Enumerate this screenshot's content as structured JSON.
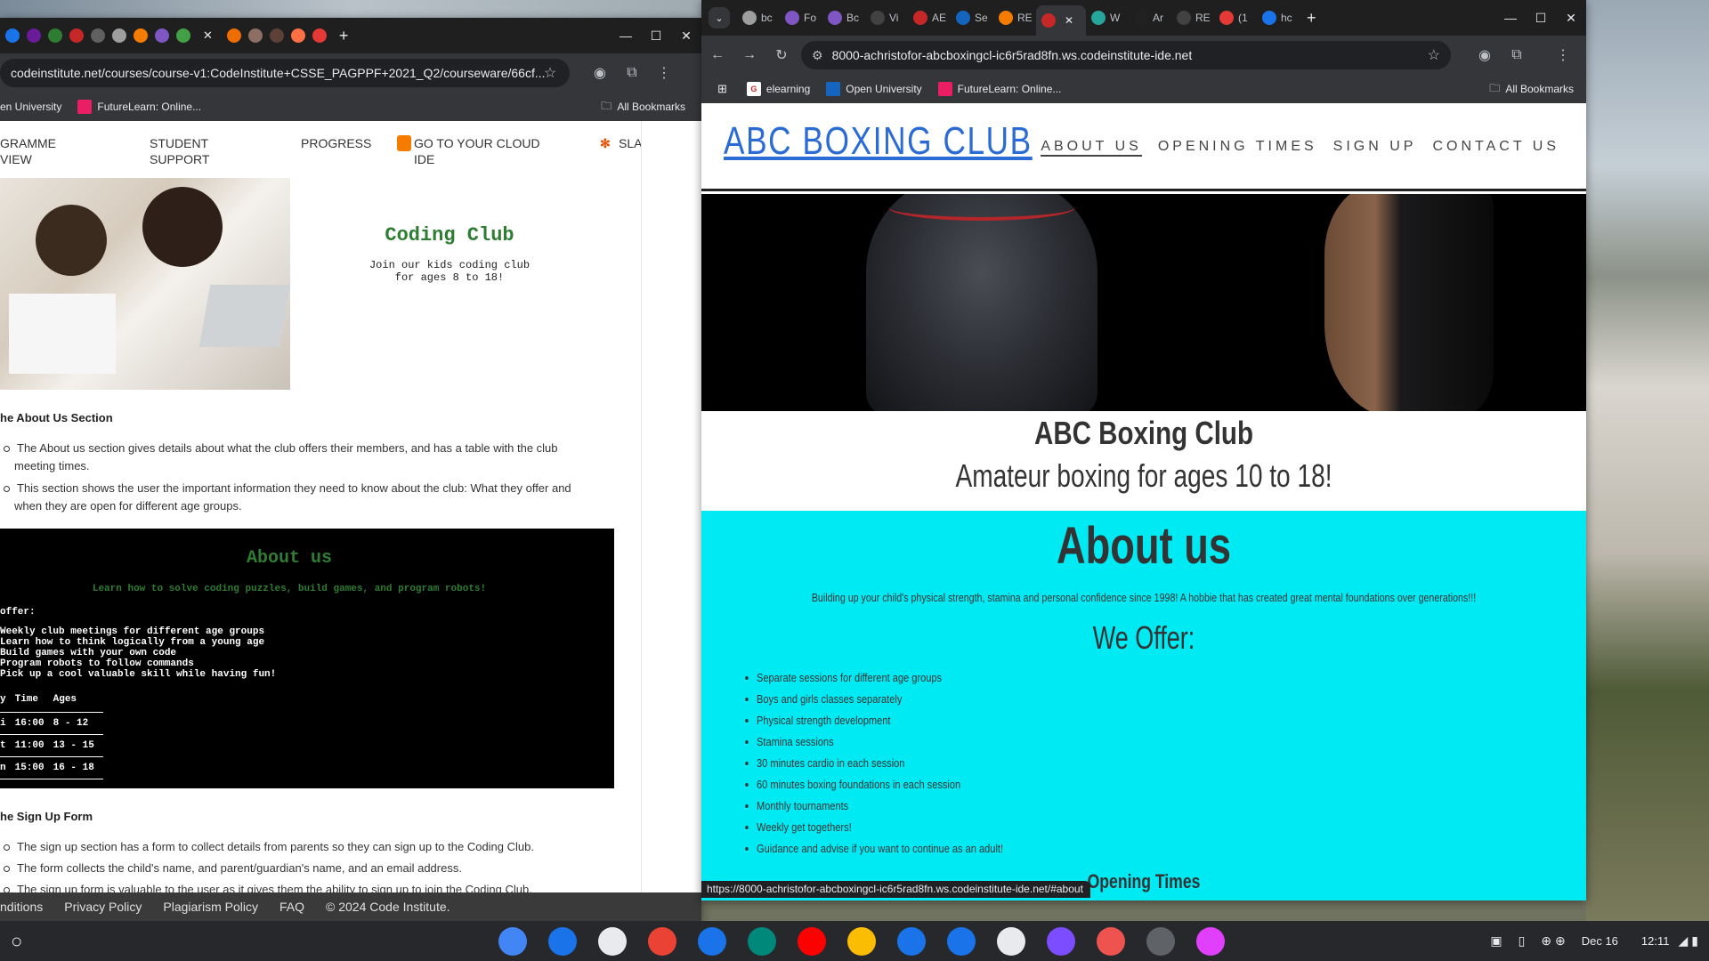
{
  "left_window": {
    "tabs_favicons": [
      "#1a73e8",
      "#6a1b9a",
      "#2e7d32",
      "#c62828",
      "#616161",
      "#9e9e9e",
      "#f57c00",
      "#7e57c2",
      "#43a047",
      "#ef6c00",
      "#8d6e63",
      "#5d4037",
      "#ff7043",
      "#e53935"
    ],
    "new_tab": "+",
    "close_tab": "✕",
    "url": "codeinstitute.net/courses/course-v1:CodeInstitute+CSSE_PAGPPF+2021_Q2/courseware/66cf...",
    "bookmarks": [
      {
        "label": "en University"
      },
      {
        "label": "FutureLearn: Online..."
      },
      {
        "label": "All Bookmarks"
      }
    ],
    "nav": {
      "programme_overview": "GRAMME\nVIEW",
      "student_support": "STUDENT\nSUPPORT",
      "progress": "PROGRESS",
      "cloud_ide": "GO TO YOUR CLOUD\nIDE",
      "slack": "SLACK"
    },
    "preview": {
      "title": "Coding Club",
      "subtitle_line1": "Join our kids coding club",
      "subtitle_line2": "for ages 8 to 18!"
    },
    "about_section": {
      "heading": "he About Us Section",
      "bullets": [
        "The About us section gives details about what the club offers their members, and has a table with the club",
        "meeting times.",
        "This section shows the user the important information they need to know about the club: What they offer and",
        "when they are open for different age groups."
      ]
    },
    "dark_preview": {
      "title": "About us",
      "tagline": "Learn how to solve coding puzzles, build games, and program robots!",
      "offer_label": "offer:",
      "offers": [
        "Weekly club meetings for different age groups",
        "Learn how to think logically from a young age",
        "Build games with your own code",
        "Program robots to follow commands",
        "Pick up a cool valuable skill while having fun!"
      ],
      "table_headers": [
        "y",
        "Time",
        "Ages"
      ],
      "table_rows": [
        [
          "i",
          "16:00",
          "8 - 12"
        ],
        [
          "t",
          "11:00",
          "13 - 15"
        ],
        [
          "n",
          "15:00",
          "16 - 18"
        ]
      ]
    },
    "signup_section": {
      "heading": "he Sign Up Form",
      "bullets": [
        "The sign up section has a form to collect details from parents so they can sign up to the Coding Club.",
        "The form collects the child's name, and parent/guardian's name, and an email address.",
        "The sign up form is valuable to the user as it gives them the ability to sign up to join the Coding Club."
      ]
    },
    "footer": [
      "nditions",
      "Privacy Policy",
      "Plagiarism Policy",
      "FAQ",
      "© 2024 Code Institute."
    ]
  },
  "right_window": {
    "tabs": [
      {
        "label": "bc",
        "fav": "#9e9e9e"
      },
      {
        "label": "Fo",
        "fav": "#7e57c2"
      },
      {
        "label": "Bc",
        "fav": "#7e57c2"
      },
      {
        "label": "Vi",
        "fav": "#424242"
      },
      {
        "label": "AE",
        "fav": "#c62828"
      },
      {
        "label": "Se",
        "fav": "#1565c0"
      },
      {
        "label": "RE",
        "fav": "#f57c00"
      },
      {
        "label": "",
        "fav": "#c62828"
      },
      {
        "label": "W",
        "fav": "#26a69a"
      },
      {
        "label": "Ar",
        "fav": "#212121"
      },
      {
        "label": "RE",
        "fav": "#424242"
      },
      {
        "label": "(1",
        "fav": "#e53935"
      },
      {
        "label": "hc",
        "fav": "#1a73e8"
      }
    ],
    "new_tab": "+",
    "close_tab": "✕",
    "url": "8000-achristofor-abcboxingcl-ic6r5rad8fn.ws.codeinstitute-ide.net",
    "bookmarks": [
      {
        "label": "elearning"
      },
      {
        "label": "Open University"
      },
      {
        "label": "FutureLearn: Online..."
      },
      {
        "label": "All Bookmarks"
      }
    ],
    "site": {
      "logo": "ABC BOXING CLUB",
      "nav": [
        "ABOUT US",
        "OPENING TIMES",
        "SIGN UP",
        "CONTACT US"
      ],
      "title": "ABC Boxing Club",
      "subtitle": "Amateur boxing for ages 10 to 18!",
      "about_heading": "About us",
      "about_text": "Building up your child's physical strength, stamina and personal confidence since 1998! A hobbie that has created great mental foundations over generations!!!",
      "offer_heading": "We Offer:",
      "offers": [
        "Separate sessions for different age groups",
        "Boys and girls classes separately",
        "Physical strength development",
        "Stamina sessions",
        "30 minutes cardio in each session",
        "60 minutes boxing foundations in each session",
        "Monthly tournaments",
        "Weekly get togethers!",
        "Guidance and advise if you want to continue as an adult!"
      ],
      "opening_times_heading": "Opening Times"
    },
    "status_url": "https://8000-achristofor-abcboxingcl-ic6r5rad8fn.ws.codeinstitute-ide.net/#about"
  },
  "shelf": {
    "launcher": "○",
    "apps": [
      {
        "name": "chrome",
        "color": "#4285f4"
      },
      {
        "name": "apps-grid",
        "color": "#1a73e8"
      },
      {
        "name": "gemini",
        "color": "#e8eaed"
      },
      {
        "name": "gmail",
        "color": "#ea4335"
      },
      {
        "name": "calendar",
        "color": "#1a73e8"
      },
      {
        "name": "meet",
        "color": "#00897b"
      },
      {
        "name": "youtube",
        "color": "#ff0000"
      },
      {
        "name": "photos",
        "color": "#fbbc04"
      },
      {
        "name": "messages",
        "color": "#1a73e8"
      },
      {
        "name": "files",
        "color": "#1a73e8"
      },
      {
        "name": "drive",
        "color": "#e8eaed"
      },
      {
        "name": "gallery",
        "color": "#7c4dff"
      },
      {
        "name": "canvas",
        "color": "#ef5350"
      },
      {
        "name": "terminal",
        "color": "#5f6368"
      },
      {
        "name": "notes",
        "color": "#e040fb"
      }
    ],
    "date": "Dec 16",
    "time": "12:11"
  }
}
